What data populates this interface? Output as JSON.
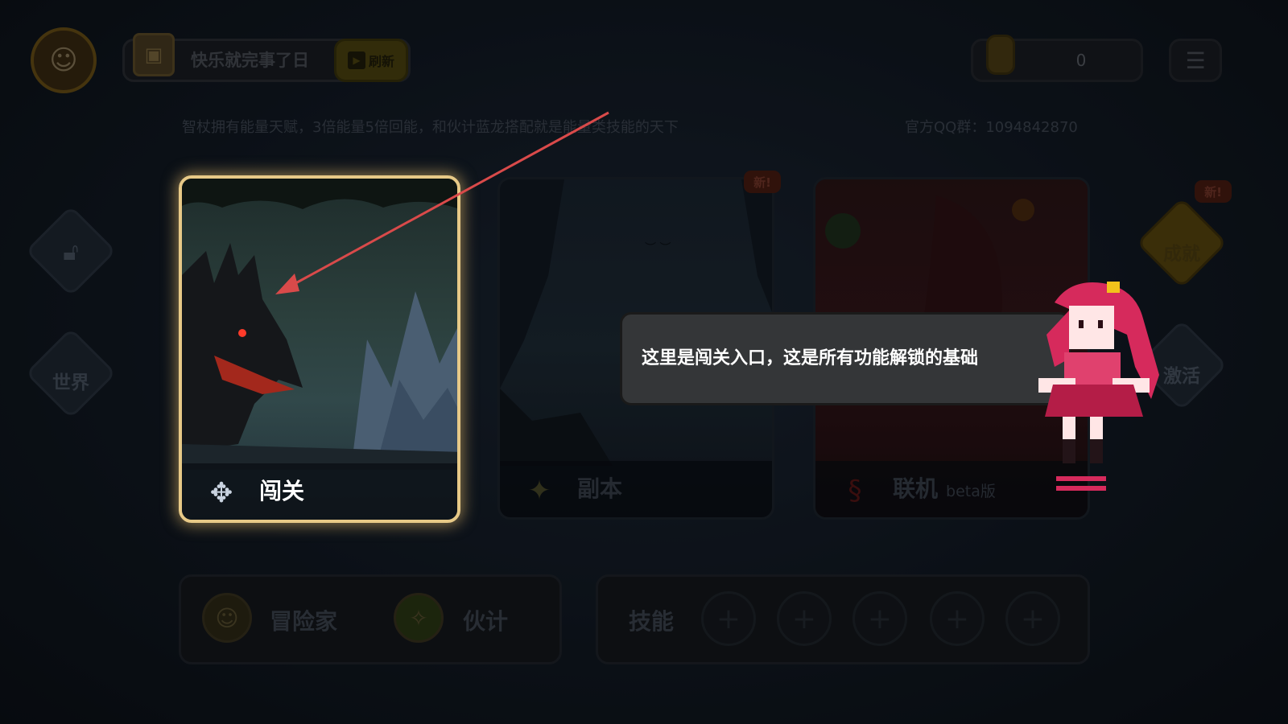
{
  "header": {
    "task_text": "快乐就完事了日",
    "refresh_label": "刷新",
    "coins": "0"
  },
  "tips": {
    "hint": "智杖拥有能量天赋，3倍能量5倍回能，和伙计蓝龙搭配就是能量类技能的天下",
    "qq": "官方QQ群：1094842870"
  },
  "sidebar_left": {
    "world_label": "世界"
  },
  "sidebar_right": {
    "achievement_label": "成就",
    "activate_label": "激活",
    "new_badge": "新!"
  },
  "cards": [
    {
      "label": "闯关",
      "suffix": "",
      "new_badge": ""
    },
    {
      "label": "副本",
      "suffix": "",
      "new_badge": "新!"
    },
    {
      "label": "联机",
      "suffix": "beta版",
      "new_badge": ""
    }
  ],
  "bottom": {
    "adventurer_label": "冒险家",
    "partner_label": "伙计",
    "skills_label": "技能",
    "skill_slots": [
      "+",
      "+",
      "+",
      "+",
      "+"
    ]
  },
  "tutorial": {
    "message": "这里是闯关入口，这是所有功能解锁的基础"
  },
  "colors": {
    "highlight_border": "#e7c987",
    "tooltip_bg": "#343638",
    "arrow": "#d94a4a",
    "guide_hair": "#d62a5c"
  },
  "icons": {
    "menu": "hamburger-icon",
    "lock": "lock-icon",
    "coin": "coin-icon",
    "play": "play-icon"
  }
}
